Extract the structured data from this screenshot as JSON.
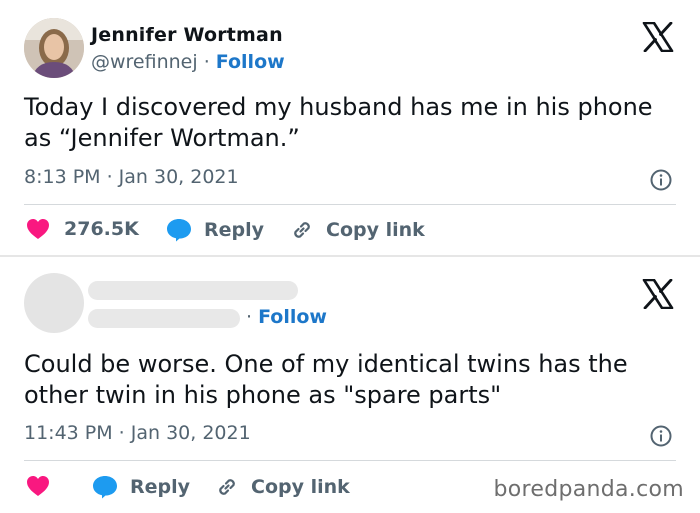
{
  "tweet1": {
    "author_name": "Jennifer Wortman",
    "handle": "@wrefinnej",
    "separator": " · ",
    "follow_label": "Follow",
    "text": "Today I discovered my husband has me in his phone as “Jennifer Wortman.”",
    "timestamp": "8:13 PM · Jan 30, 2021",
    "likes": "276.5K",
    "reply_label": "Reply",
    "copy_label": "Copy link"
  },
  "tweet2": {
    "separator": "· ",
    "follow_label": "Follow",
    "text": "Could be worse. One of my identical twins has the other twin in his phone as \"spare parts\"",
    "timestamp": "11:43 PM · Jan 30, 2021",
    "reply_label": "Reply",
    "copy_label": "Copy link"
  },
  "watermark": "boredpanda.com",
  "colors": {
    "like": "#f91880",
    "reply": "#1d9bf0",
    "follow": "#1d77c9",
    "muted": "#536471"
  },
  "icons": [
    "x-logo-icon",
    "info-icon",
    "heart-icon",
    "reply-bubble-icon",
    "link-icon"
  ]
}
